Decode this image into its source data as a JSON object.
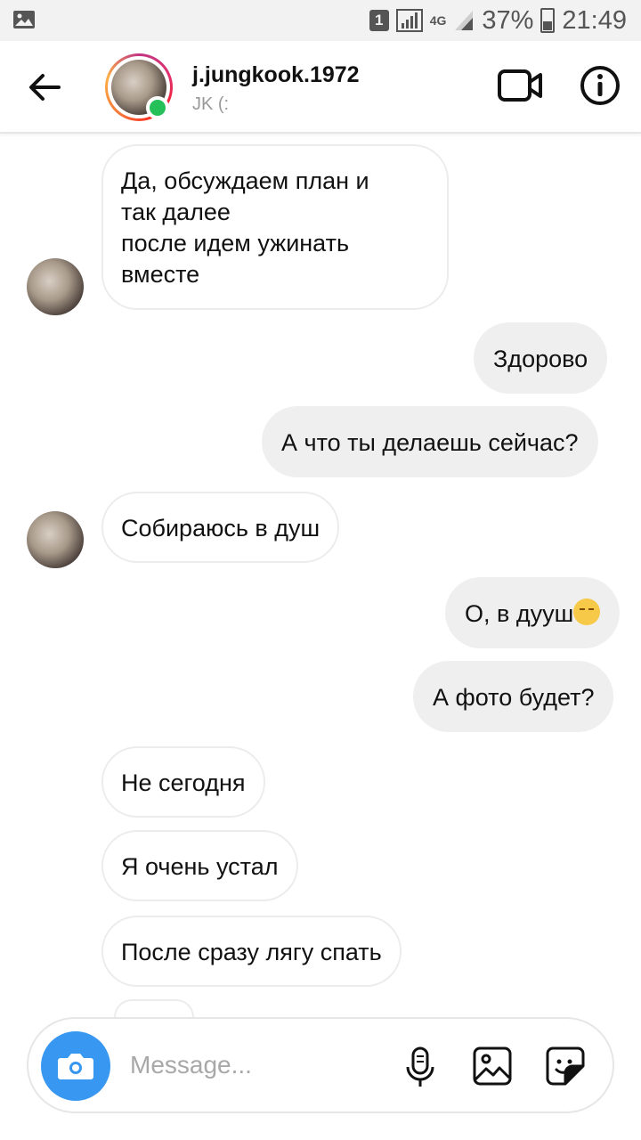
{
  "status_bar": {
    "sim_slot": "1",
    "network": "4G",
    "battery": "37%",
    "time": "21:49"
  },
  "header": {
    "username": "j.jungkook.1972",
    "subtitle": "JK (:",
    "online": true
  },
  "messages": [
    {
      "side": "in",
      "text_lines": [
        "Да, обсуждаем план и",
        "так далее",
        "после идем ужинать",
        "вместе"
      ]
    },
    {
      "side": "out",
      "text": "Здорово"
    },
    {
      "side": "out",
      "text": "А что ты делаешь сейчас?"
    },
    {
      "side": "in",
      "text": "Собираюсь в душ"
    },
    {
      "side": "out",
      "text": "О, в дууш",
      "emoji": "pensive-face"
    },
    {
      "side": "out",
      "text": "А фото будет?"
    },
    {
      "side": "in",
      "text": "Не сегодня"
    },
    {
      "side": "in",
      "text": "Я очень устал"
    },
    {
      "side": "in",
      "text": "После сразу лягу спать"
    }
  ],
  "composer": {
    "placeholder": "Message...",
    "value": ""
  },
  "colors": {
    "accent": "#3897f0",
    "online": "#26c05a",
    "outgoing_bubble": "#efefef",
    "incoming_border": "#ececec"
  }
}
